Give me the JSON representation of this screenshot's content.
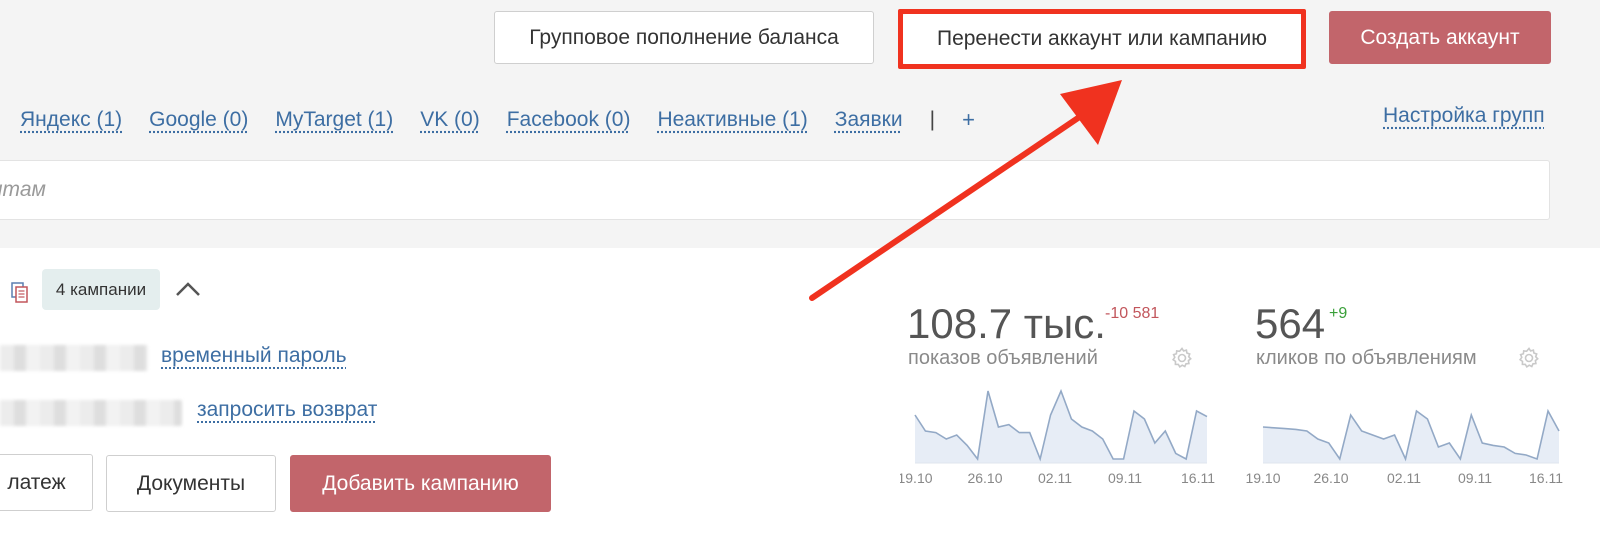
{
  "toolbar": {
    "group_topup_label": "Групповое пополнение баланса",
    "transfer_label": "Перенести аккаунт или кампанию",
    "create_label": "Создать аккаунт"
  },
  "tabs": [
    {
      "label": "Яндекс (1)"
    },
    {
      "label": "Google (0)"
    },
    {
      "label": "MyTarget (1)"
    },
    {
      "label": "VK (0)"
    },
    {
      "label": "Facebook (0)"
    },
    {
      "label": "Неактивные (1)"
    },
    {
      "label": "Заявки"
    }
  ],
  "tabs_separator": "|",
  "tabs_add": "+",
  "tabs_settings": "Настройка групп",
  "search": {
    "placeholder": "нтам"
  },
  "card": {
    "campaigns_badge": "4 кампании",
    "temp_password_link": "временный пароль",
    "refund_link": "запросить возврат",
    "payment_button": "латеж",
    "documents_button": "Документы",
    "add_campaign_button": "Добавить кампанию"
  },
  "stats": [
    {
      "value": "108.7 тыс.",
      "delta": "-10 581",
      "delta_color": "#c2565c",
      "label": "показов объявлений"
    },
    {
      "value": "564",
      "delta": "+9",
      "delta_color": "#3aa03a",
      "label": "кликов по объявлениям"
    }
  ],
  "colors": {
    "accent": "#c2656b",
    "link": "#3d6ea3",
    "highlight": "#f0321f",
    "chart_line": "#93a9c6",
    "chart_fill": "#e7edf6"
  },
  "chart_data": [
    {
      "type": "area",
      "x_ticks": [
        "19.10",
        "26.10",
        "02.11",
        "09.11",
        "16.11"
      ],
      "values": [
        60,
        40,
        38,
        30,
        35,
        22,
        5,
        90,
        45,
        48,
        38,
        38,
        5,
        60,
        90,
        55,
        45,
        40,
        30,
        5,
        5,
        65,
        55,
        25,
        40,
        12,
        5,
        65,
        58
      ]
    },
    {
      "type": "area",
      "x_ticks": [
        "19.10",
        "26.10",
        "02.11",
        "09.11",
        "16.11"
      ],
      "values": [
        45,
        44,
        43,
        42,
        40,
        30,
        25,
        5,
        60,
        40,
        35,
        30,
        35,
        5,
        65,
        55,
        20,
        25,
        5,
        60,
        25,
        22,
        20,
        12,
        10,
        5,
        65,
        40
      ]
    }
  ]
}
